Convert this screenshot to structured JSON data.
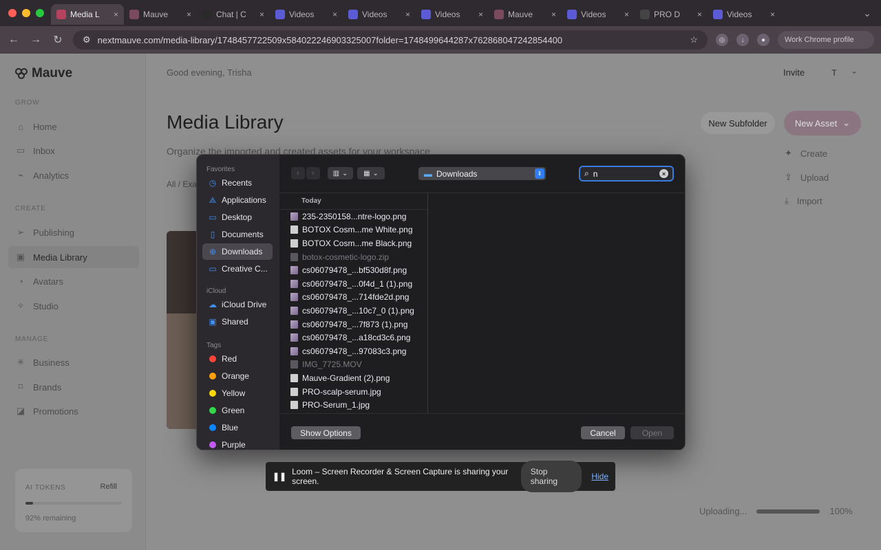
{
  "browser": {
    "tabs": [
      {
        "label": "Media L",
        "favicon_color": "#b5425f",
        "active": true
      },
      {
        "label": "Mauve",
        "favicon_color": "#7c4a5d",
        "active": false
      },
      {
        "label": "Chat | C",
        "favicon_color": "#2a2a2a",
        "active": false
      },
      {
        "label": "Videos",
        "favicon_color": "#5b5bd6",
        "active": false
      },
      {
        "label": "Videos",
        "favicon_color": "#5b5bd6",
        "active": false
      },
      {
        "label": "Videos",
        "favicon_color": "#5b5bd6",
        "active": false
      },
      {
        "label": "Mauve",
        "favicon_color": "#7c4a5d",
        "active": false
      },
      {
        "label": "Videos",
        "favicon_color": "#5b5bd6",
        "active": false
      },
      {
        "label": "PRO D",
        "favicon_color": "#444444",
        "active": false
      },
      {
        "label": "Videos",
        "favicon_color": "#5b5bd6",
        "active": false
      }
    ],
    "url": "nextmauve.com/media-library/1748457722509x584022246903325007folder=1748499644287x762868047242854400",
    "profile_label": "Work Chrome profile"
  },
  "app": {
    "brand": "Mauve",
    "greeting": "Good evening, Trisha",
    "invite_label": "Invite",
    "avatar_initial": "T",
    "sections": {
      "grow": "GROW",
      "create": "CREATE",
      "manage": "MANAGE"
    },
    "nav": {
      "home": "Home",
      "inbox": "Inbox",
      "analytics": "Analytics",
      "publishing": "Publishing",
      "media_library": "Media Library",
      "avatars": "Avatars",
      "studio": "Studio",
      "business": "Business",
      "brands": "Brands",
      "promotions": "Promotions"
    },
    "tokens": {
      "label": "AI TOKENS",
      "refill": "Refill",
      "remaining_text": "92% remaining",
      "remaining_fraction": 0.08
    },
    "page_title": "Media Library",
    "subtitle": "Organize the imported and created assets for your workspace",
    "breadcrumb": "All / Exa",
    "new_subfolder": "New Subfolder",
    "new_asset": "New Asset",
    "asset_menu": {
      "create": "Create",
      "upload": "Upload",
      "import": "Import"
    },
    "upload_status": {
      "label": "Uploading...",
      "percent_text": "100%",
      "fraction": 1.0
    }
  },
  "dialog": {
    "sidebar": {
      "favorites_header": "Favorites",
      "favorites": [
        {
          "label": "Recents",
          "icon": "clock-icon"
        },
        {
          "label": "Applications",
          "icon": "applications-icon"
        },
        {
          "label": "Desktop",
          "icon": "desktop-icon"
        },
        {
          "label": "Documents",
          "icon": "document-icon"
        },
        {
          "label": "Downloads",
          "icon": "download-icon"
        },
        {
          "label": "Creative C...",
          "icon": "folder-icon"
        }
      ],
      "icloud_header": "iCloud",
      "icloud": [
        {
          "label": "iCloud Drive",
          "icon": "cloud-icon"
        },
        {
          "label": "Shared",
          "icon": "shared-folder-icon"
        }
      ],
      "tags_header": "Tags",
      "tags": [
        {
          "label": "Red",
          "color": "#ff453a"
        },
        {
          "label": "Orange",
          "color": "#ff9f0a"
        },
        {
          "label": "Yellow",
          "color": "#ffd60a"
        },
        {
          "label": "Green",
          "color": "#32d74b"
        },
        {
          "label": "Blue",
          "color": "#0a84ff"
        },
        {
          "label": "Purple",
          "color": "#bf5af2"
        }
      ]
    },
    "location": "Downloads",
    "search_value": "n",
    "section_header": "Today",
    "files": [
      {
        "name": "235-2350158...ntre-logo.png",
        "dim": false
      },
      {
        "name": "BOTOX Cosm...me White.png",
        "dim": false
      },
      {
        "name": "BOTOX Cosm...me Black.png",
        "dim": false
      },
      {
        "name": "botox-cosmetic-logo.zip",
        "dim": true
      },
      {
        "name": "cs06079478_...bf530d8f.png",
        "dim": false
      },
      {
        "name": "cs06079478_...0f4d_1 (1).png",
        "dim": false
      },
      {
        "name": "cs06079478_...714fde2d.png",
        "dim": false
      },
      {
        "name": "cs06079478_...10c7_0 (1).png",
        "dim": false
      },
      {
        "name": "cs06079478_...7f873 (1).png",
        "dim": false
      },
      {
        "name": "cs06079478_...a18cd3c6.png",
        "dim": false
      },
      {
        "name": "cs06079478_...97083c3.png",
        "dim": false
      },
      {
        "name": "IMG_7725.MOV",
        "dim": true
      },
      {
        "name": "Mauve-Gradient (2).png",
        "dim": false
      },
      {
        "name": "PRO-scalp-serum.jpg",
        "dim": false
      },
      {
        "name": "PRO-Serum_1.jpg",
        "dim": false
      }
    ],
    "show_options": "Show Options",
    "cancel": "Cancel",
    "open": "Open"
  },
  "loom": {
    "message": "Loom – Screen Recorder & Screen Capture is sharing your screen.",
    "stop": "Stop sharing",
    "hide": "Hide"
  }
}
